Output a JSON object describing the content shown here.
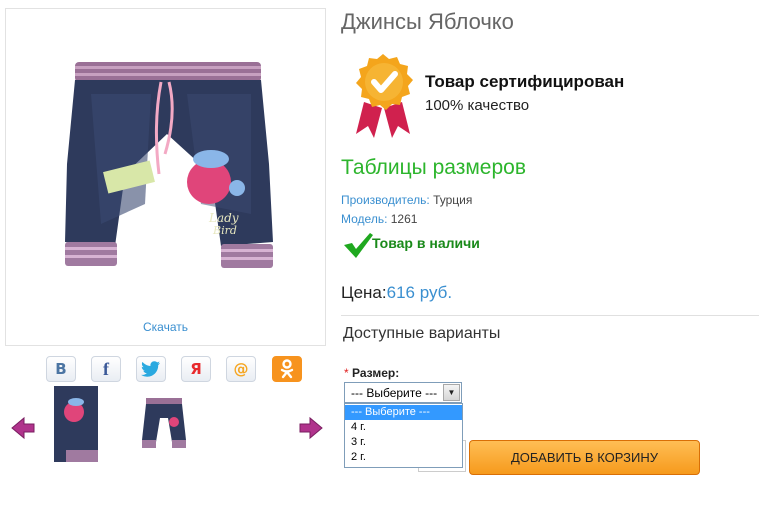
{
  "product": {
    "title": "Джинсы Яблочко",
    "download_link": "Скачать"
  },
  "social": {
    "vk": "В",
    "fb": "f",
    "tw": "🐦",
    "ya": "Я",
    "mail": "@",
    "ok": "ok"
  },
  "certificate": {
    "title": "Товар сертифицирован",
    "subtitle": "100% качество"
  },
  "size_tables_link": "Таблицы размеров",
  "info": {
    "manufacturer_label": "Производитель:",
    "manufacturer_value": "Турция",
    "model_label": "Модель:",
    "model_value": "1261"
  },
  "stock": "Товар в наличи",
  "price": {
    "label": "Цена:",
    "value": "616 руб."
  },
  "variants": {
    "title": "Доступные варианты",
    "required_mark": "*",
    "size_label": "Размер:",
    "selected": "--- Выберите ---",
    "options": [
      "--- Выберите ---",
      "4 г.",
      "3 г.",
      "2 г."
    ]
  },
  "cart_button": "ДОБАВИТЬ В КОРЗИНУ",
  "colors": {
    "link_blue": "#3a8fd0",
    "green": "#2cb52c",
    "orange_button": "#f69a1c",
    "highlight": "#3399ff"
  }
}
